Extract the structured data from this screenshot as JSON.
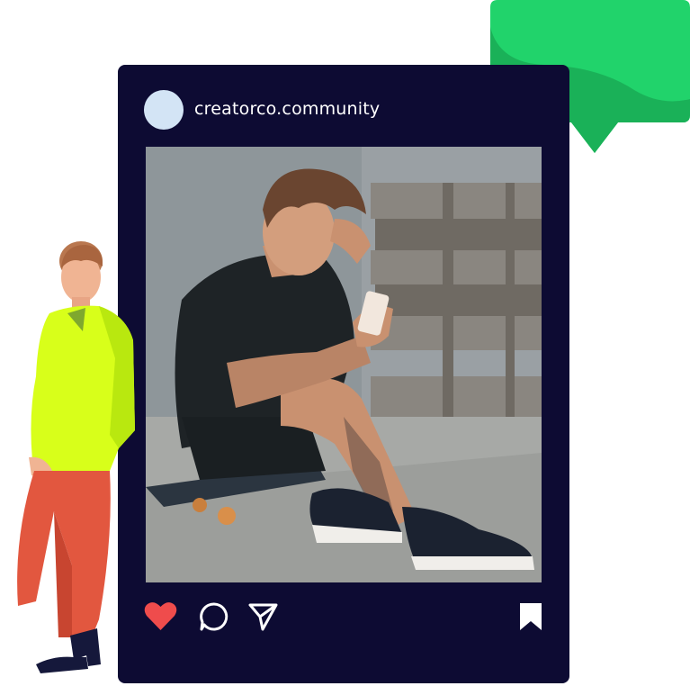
{
  "post": {
    "username": "creatorco.community",
    "photo_description": "",
    "actions": {
      "like_icon": "heart-icon",
      "comment_icon": "comment-icon",
      "share_icon": "send-icon",
      "save_icon": "bookmark-icon"
    }
  },
  "colors": {
    "card_background": "#0d0b33",
    "avatar": "#d3e4f5",
    "like_active": "#ef4c4c",
    "bubble_green": "#21d36b",
    "bubble_dark_green": "#1ab158",
    "figure_shirt": "#d8ff1a",
    "figure_pants": "#e2573f"
  }
}
